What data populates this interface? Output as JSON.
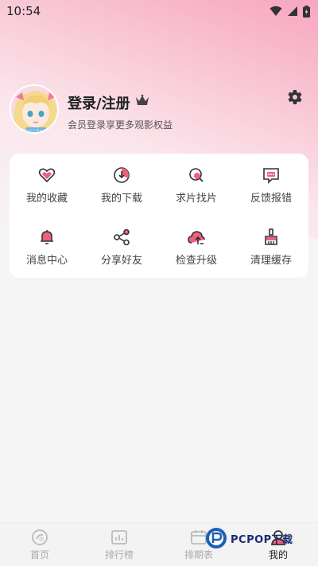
{
  "status_bar": {
    "time": "10:54"
  },
  "profile": {
    "title": "登录/注册",
    "subtitle": "会员登录享更多观影权益",
    "avatar_badge": "ツインテール"
  },
  "menu": [
    {
      "label": "我的收藏",
      "icon": "heart-icon"
    },
    {
      "label": "我的下载",
      "icon": "download-icon"
    },
    {
      "label": "求片找片",
      "icon": "search-film-icon"
    },
    {
      "label": "反馈报错",
      "icon": "feedback-icon"
    },
    {
      "label": "消息中心",
      "icon": "bell-icon"
    },
    {
      "label": "分享好友",
      "icon": "share-icon"
    },
    {
      "label": "检查升级",
      "icon": "upgrade-icon"
    },
    {
      "label": "清理缓存",
      "icon": "clean-icon"
    }
  ],
  "tabs": [
    {
      "label": "首页",
      "icon": "home-icon"
    },
    {
      "label": "排行榜",
      "icon": "ranking-icon"
    },
    {
      "label": "排期表",
      "icon": "calendar-icon"
    },
    {
      "label": "我的",
      "icon": "profile-icon"
    }
  ],
  "watermark": {
    "text": "PCPOP下载"
  },
  "colors": {
    "accent": "#f0607e",
    "icon_stroke": "#333333"
  }
}
